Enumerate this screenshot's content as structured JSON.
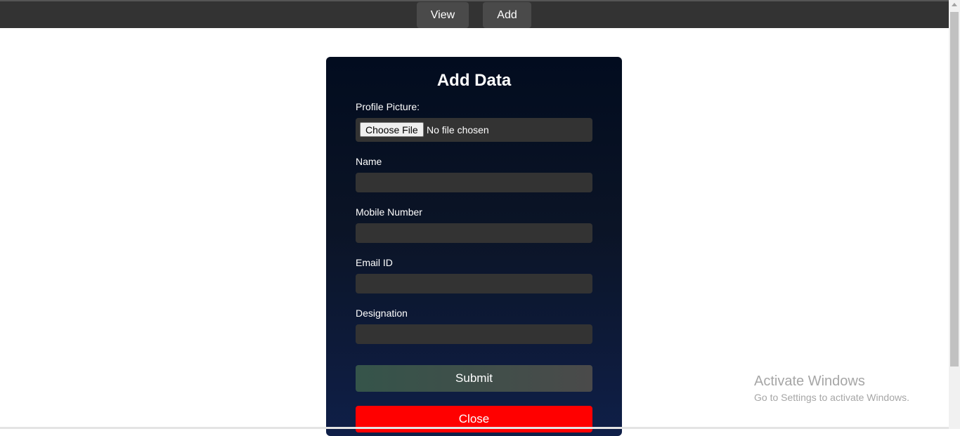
{
  "nav": {
    "view_label": "View",
    "add_label": "Add"
  },
  "form": {
    "title": "Add Data",
    "profile_picture_label": "Profile Picture:",
    "choose_file_label": "Choose File",
    "file_status": "No file chosen",
    "name_label": "Name",
    "name_value": "",
    "mobile_label": "Mobile Number",
    "mobile_value": "",
    "email_label": "Email ID",
    "email_value": "",
    "designation_label": "Designation",
    "designation_value": "",
    "submit_label": "Submit",
    "close_label": "Close"
  },
  "watermark": {
    "title": "Activate Windows",
    "subtitle": "Go to Settings to activate Windows."
  },
  "colors": {
    "topbar": "#333333",
    "nav_button": "#4a4a4a",
    "modal_top": "#020c1f",
    "modal_bottom": "#0f1f48",
    "input_bg": "#333333",
    "close_button": "#ff0000",
    "submit_gradient_start": "#35544a"
  }
}
